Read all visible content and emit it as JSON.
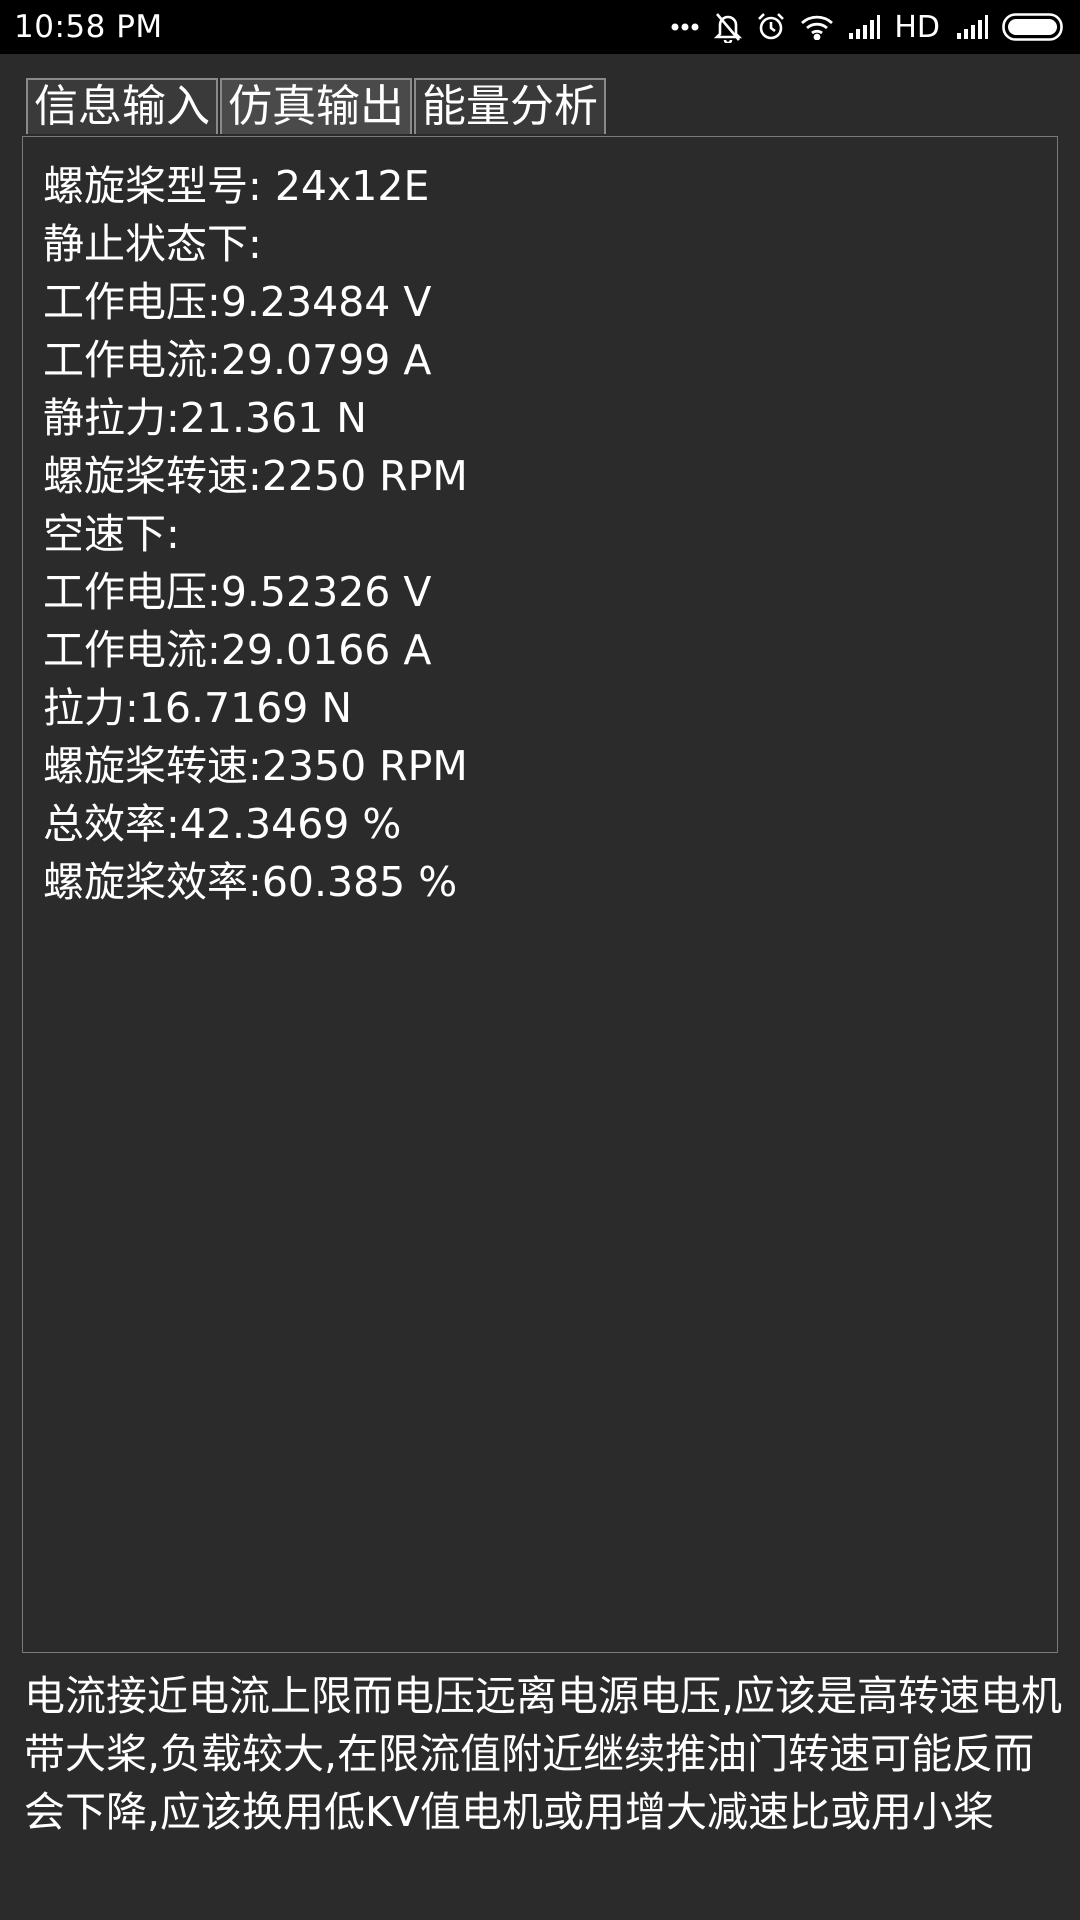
{
  "status_bar": {
    "time": "10:58 PM",
    "network_label": "HD",
    "icons": [
      "more-dots-icon",
      "bell-muted-icon",
      "alarm-icon",
      "wifi-icon",
      "signal-icon",
      "signal-icon",
      "battery-icon"
    ]
  },
  "tabs": [
    {
      "label": "信息输入",
      "active": false
    },
    {
      "label": "仿真输出",
      "active": true
    },
    {
      "label": "能量分析",
      "active": false
    }
  ],
  "results": {
    "lines": [
      "螺旋桨型号: 24x12E",
      "静止状态下:",
      "工作电压:9.23484 V",
      "工作电流:29.0799 A",
      "静拉力:21.361 N",
      "螺旋桨转速:2250 RPM",
      "空速下:",
      "工作电压:9.52326 V",
      "工作电流:29.0166 A",
      "拉力:16.7169 N",
      "螺旋桨转速:2350 RPM",
      "总效率:42.3469 %",
      "螺旋桨效率:60.385 %"
    ]
  },
  "advice": "电流接近电流上限而电压远离电源电压,应该是高转速电机带大桨,负载较大,在限流值附近继续推油门转速可能反而会下降,应该换用低KV值电机或用增大减速比或用小桨"
}
